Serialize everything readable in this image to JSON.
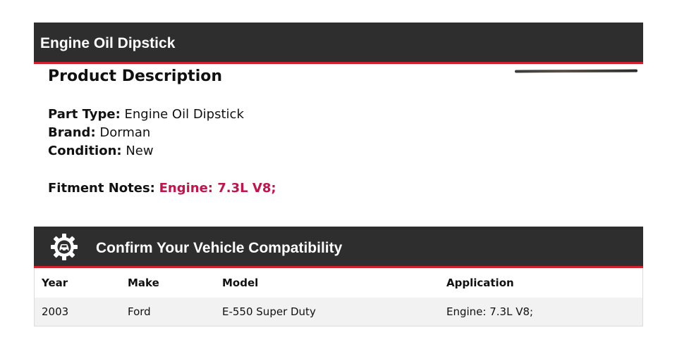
{
  "header": {
    "title": "Engine Oil Dipstick"
  },
  "description": {
    "heading": "Product Description",
    "part_type_label": "Part Type:",
    "part_type": "Engine Oil Dipstick",
    "brand_label": "Brand:",
    "brand": "Dorman",
    "condition_label": "Condition:",
    "condition": "New",
    "fitment_label": "Fitment Notes:",
    "fitment": "Engine: 7.3L V8;"
  },
  "compatibility": {
    "title": "Confirm Your Vehicle Compatibility",
    "icon": "gear-car-icon",
    "columns": [
      "Year",
      "Make",
      "Model",
      "Application"
    ],
    "rows": [
      [
        "2003",
        "Ford",
        "E-550 Super Duty",
        "Engine: 7.3L V8;"
      ]
    ]
  },
  "colors": {
    "bar": "#2e2e2e",
    "accent": "#d0202e",
    "fitment": "#c2134a"
  }
}
